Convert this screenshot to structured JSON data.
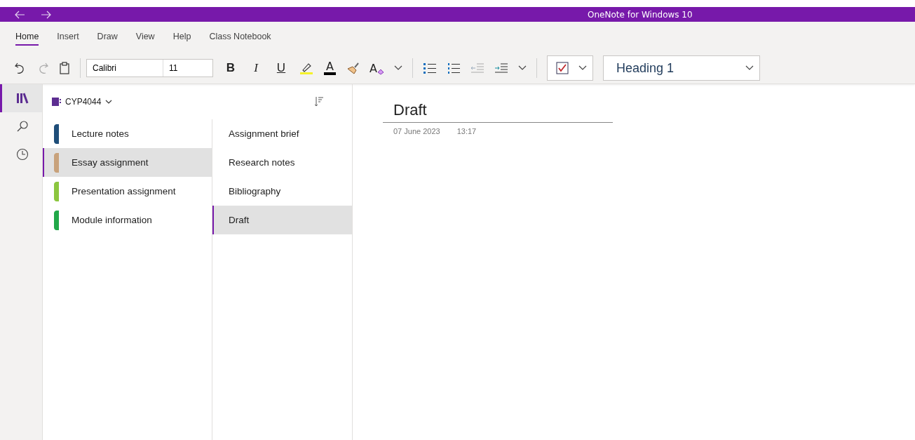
{
  "window": {
    "title": "OneNote for Windows 10"
  },
  "tabs": [
    {
      "label": "Home",
      "selected": true
    },
    {
      "label": "Insert",
      "selected": false
    },
    {
      "label": "Draw",
      "selected": false
    },
    {
      "label": "View",
      "selected": false
    },
    {
      "label": "Help",
      "selected": false
    },
    {
      "label": "Class Notebook",
      "selected": false
    }
  ],
  "toolbar": {
    "font": "Calibri",
    "size": "11",
    "format_buttons": [
      {
        "label": "B",
        "kind": "bold"
      },
      {
        "label": "I",
        "kind": "italic"
      },
      {
        "label": "U",
        "kind": "underline"
      }
    ],
    "font_color_glyph": "A",
    "clear_format_glyph": "A",
    "tag_checked": true,
    "style": "Heading 1"
  },
  "rail": [
    {
      "kind": "notebooks",
      "selected": true
    },
    {
      "kind": "search",
      "selected": false
    },
    {
      "kind": "recent",
      "selected": false
    }
  ],
  "notebook": {
    "name": "CYP4044"
  },
  "sections": [
    {
      "label": "Lecture notes",
      "color": "#1f4e79",
      "selected": false
    },
    {
      "label": "Essay assignment",
      "color": "#c8a27c",
      "selected": true
    },
    {
      "label": "Presentation assignment",
      "color": "#8cc63f",
      "selected": false
    },
    {
      "label": "Module information",
      "color": "#21a849",
      "selected": false
    }
  ],
  "pages": [
    {
      "label": "Assignment brief",
      "selected": false
    },
    {
      "label": "Research notes",
      "selected": false
    },
    {
      "label": "Bibliography",
      "selected": false
    },
    {
      "label": "Draft",
      "selected": true
    }
  ],
  "page": {
    "title": "Draft",
    "date": "07 June 2023",
    "time": "13:17"
  }
}
